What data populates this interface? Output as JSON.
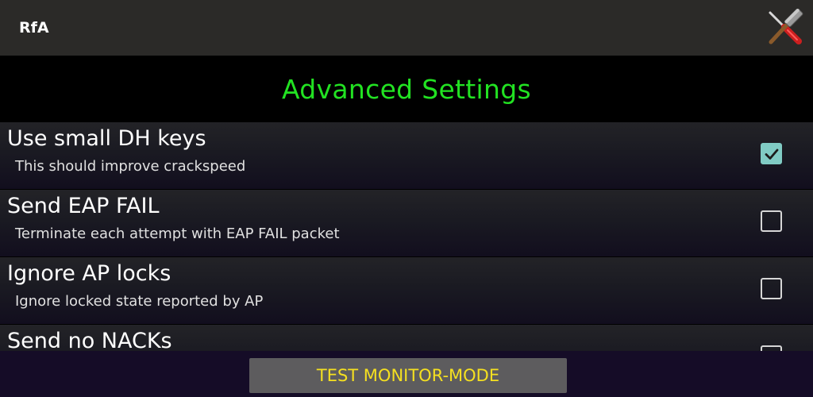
{
  "appbar": {
    "title": "RfA",
    "tools_icon": "hammer-screwdriver-icon"
  },
  "header": {
    "title": "Advanced Settings"
  },
  "settings": [
    {
      "title": "Use small DH keys",
      "subtitle": "This should improve crackspeed",
      "checked": true
    },
    {
      "title": "Send EAP FAIL",
      "subtitle": "Terminate each attempt with EAP FAIL packet",
      "checked": false
    },
    {
      "title": "Ignore AP locks",
      "subtitle": "Ignore locked state reported by AP",
      "checked": false
    },
    {
      "title": "Send no NACKs",
      "subtitle": "",
      "checked": false
    }
  ],
  "bottom": {
    "button_label": "TEST MONITOR-MODE"
  },
  "colors": {
    "header_text": "#22e222",
    "checkbox_checked": "#80cbc4",
    "button_text": "#f5e020",
    "button_bg": "#5d5c5e"
  }
}
